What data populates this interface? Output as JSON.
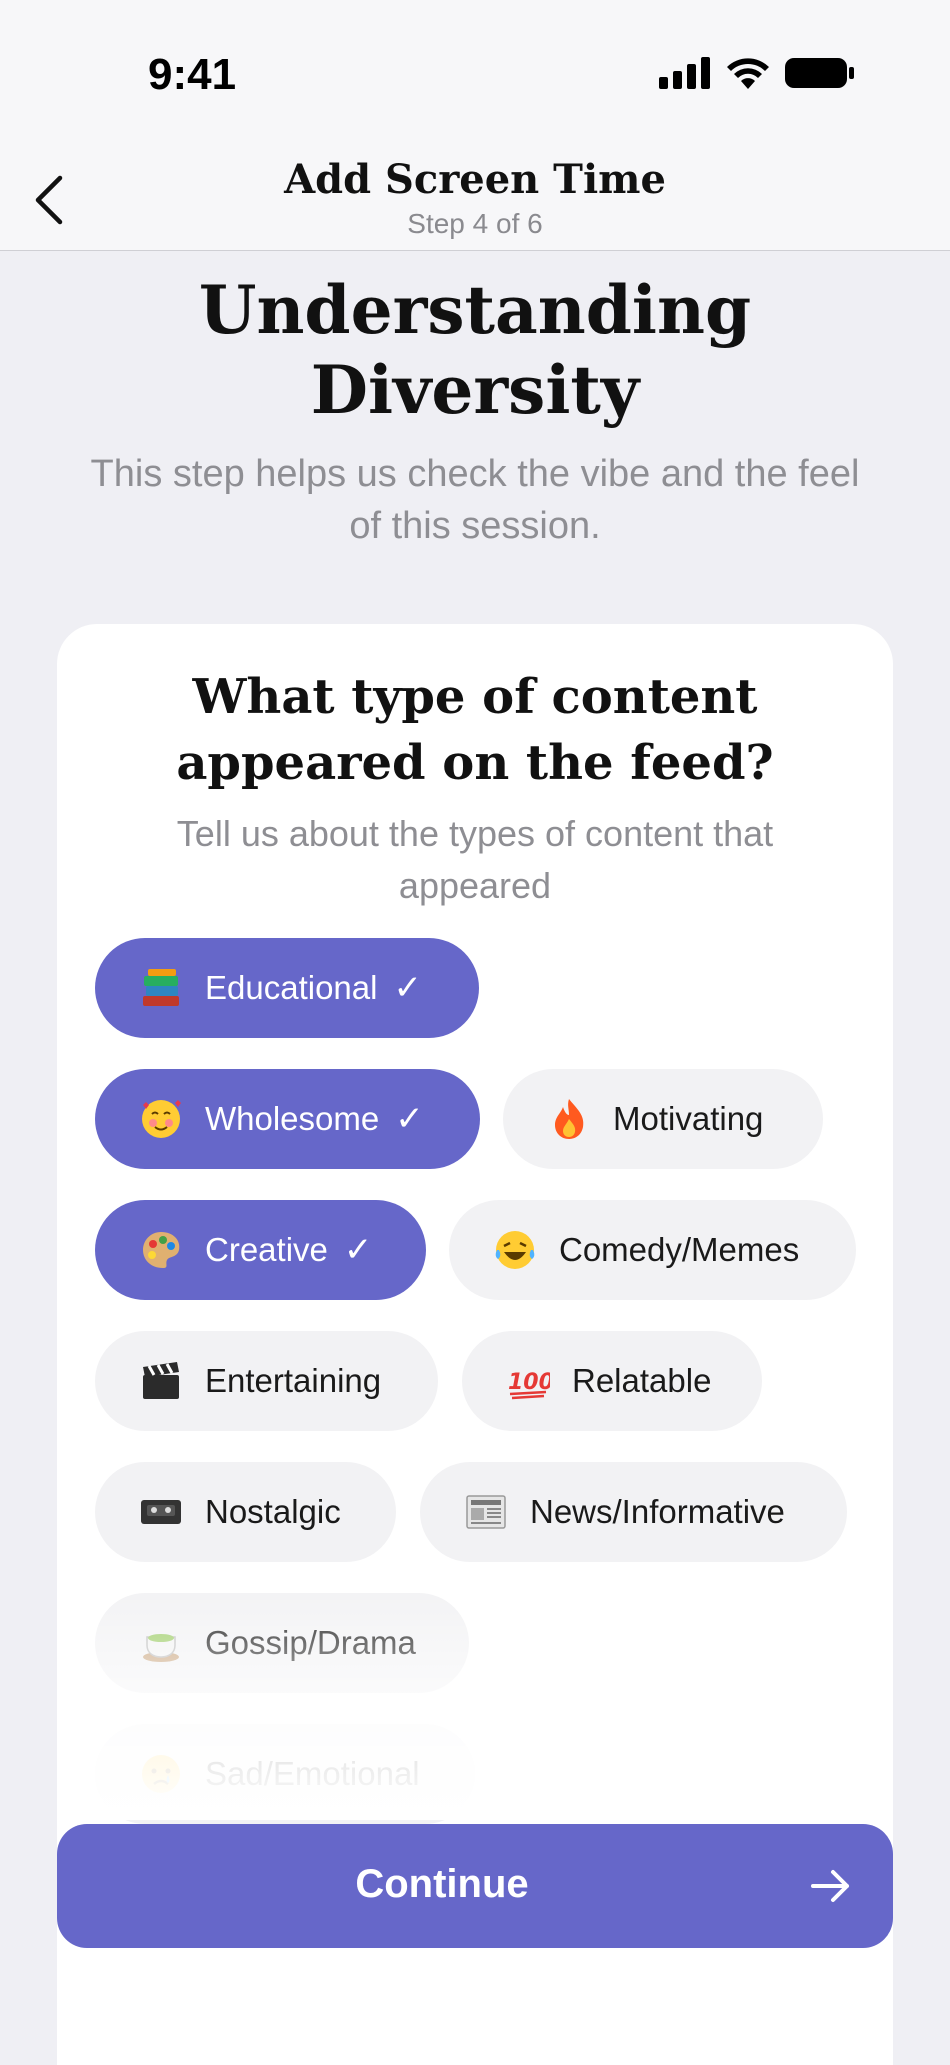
{
  "status_bar": {
    "time": "9:41"
  },
  "nav": {
    "title": "Add Screen Time",
    "step": "Step 4 of 6"
  },
  "page": {
    "title_line1": "Understanding",
    "title_line2": "Diversity",
    "subtitle": "This step helps us check the vibe and the feel of this session."
  },
  "card": {
    "title_line1": "What type of content",
    "title_line2": "appeared on the feed?",
    "subtitle": "Tell us about the types of content that appeared"
  },
  "chips": [
    {
      "label": "Educational",
      "icon": "books-icon",
      "selected": true,
      "check": "✓"
    },
    {
      "label": "Wholesome",
      "icon": "smiling-hearts-icon",
      "selected": true,
      "check": "✓"
    },
    {
      "label": "Motivating",
      "icon": "fire-icon",
      "selected": false
    },
    {
      "label": "Creative",
      "icon": "palette-icon",
      "selected": true,
      "check": "✓"
    },
    {
      "label": "Comedy/Memes",
      "icon": "laughing-tears-icon",
      "selected": false
    },
    {
      "label": "Entertaining",
      "icon": "clapper-board-icon",
      "selected": false
    },
    {
      "label": "Relatable",
      "icon": "hundred-points-icon",
      "selected": false
    },
    {
      "label": "Nostalgic",
      "icon": "videocassette-icon",
      "selected": false
    },
    {
      "label": "News/Informative",
      "icon": "newspaper-icon",
      "selected": false
    },
    {
      "label": "Gossip/Drama",
      "icon": "tea-cup-icon",
      "selected": false
    },
    {
      "label": "Sad/Emotional",
      "icon": "crying-face-icon",
      "selected": false
    }
  ],
  "continue_button": {
    "label": "Continue",
    "icon": "arrow-right-icon"
  },
  "colors": {
    "accent": "#6667c9",
    "chip_bg": "#f2f2f4",
    "background": "#efeff4"
  }
}
